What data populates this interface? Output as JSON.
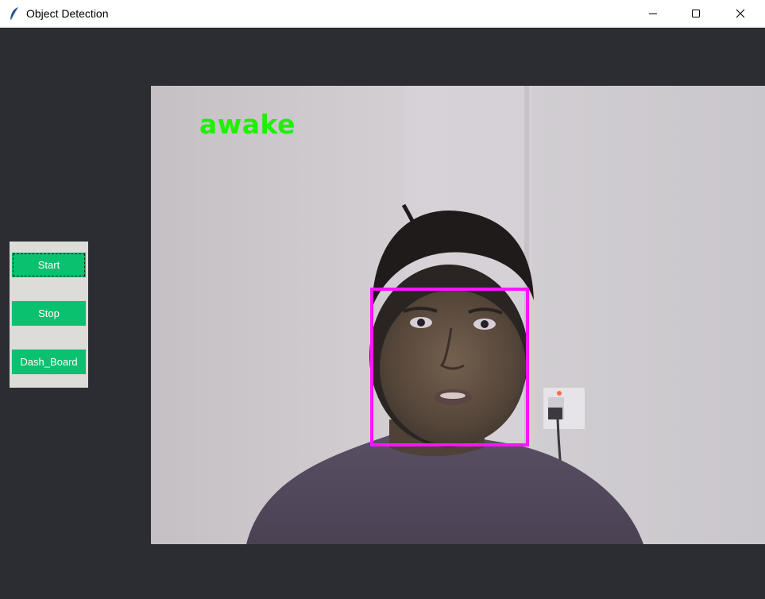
{
  "window": {
    "title": "Object Detection",
    "icon": "feather-icon",
    "controls": [
      "minimize-icon",
      "maximize-icon",
      "close-icon"
    ]
  },
  "controls": {
    "start_label": "Start",
    "stop_label": "Stop",
    "dashboard_label": "Dash_Board"
  },
  "feed": {
    "status_text": "awake",
    "status_color": "#1ef000",
    "face_box_color": "#ff14ff"
  },
  "colors": {
    "background": "#2b2d33",
    "button": "#0ac16f",
    "panel": "#dedcd9"
  }
}
